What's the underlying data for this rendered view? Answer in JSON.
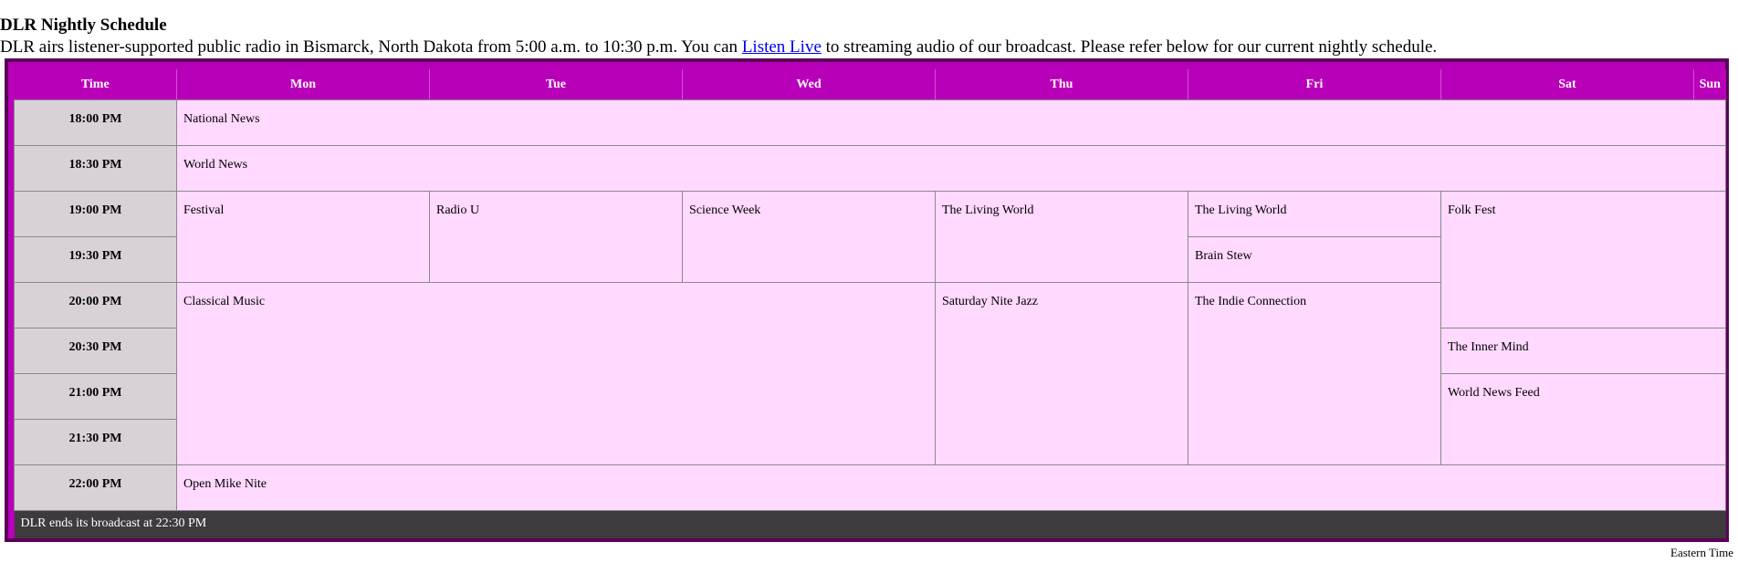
{
  "page": {
    "title": "DLR Nightly Schedule",
    "intro_before": "DLR airs listener-supported public radio in Bismarck, North Dakota from 5:00 a.m. to 10:30 p.m. You can ",
    "intro_link": "Listen Live",
    "intro_after": " to streaming audio of our broadcast. Please refer below for our current nightly schedule.",
    "timezone": "Eastern Time"
  },
  "colors": {
    "header_bg": "#b900b9",
    "cell_bg": "#ffd9ff",
    "time_bg": "#d8d2d8",
    "footer_bg": "#3d3b3d",
    "link": "#0000ee"
  },
  "schedule": {
    "headers": [
      "Time",
      "Mon",
      "Tue",
      "Wed",
      "Thu",
      "Fri",
      "Sat",
      "Sun"
    ],
    "times": [
      "18:00 PM",
      "18:30 PM",
      "19:00 PM",
      "19:30 PM",
      "20:00 PM",
      "20:30 PM",
      "21:00 PM",
      "21:30 PM",
      "22:00 PM"
    ],
    "programs": {
      "national_news": "National News",
      "world_news": "World News",
      "festival": "Festival",
      "radio_u": "Radio U",
      "science_week": "Science Week",
      "living_world_thu": "The Living World",
      "living_world_fri": "The Living World",
      "folk_fest": "Folk Fest",
      "brain_stew": "Brain Stew",
      "classical_music": "Classical Music",
      "saturday_nite_jazz": "Saturday Nite Jazz",
      "indie_connection": "The Indie Connection",
      "inner_mind": "The Inner Mind",
      "world_news_feed": "World News Feed",
      "open_mike_nite": "Open Mike Nite"
    },
    "footer": "DLR ends its broadcast at 22:30 PM"
  }
}
